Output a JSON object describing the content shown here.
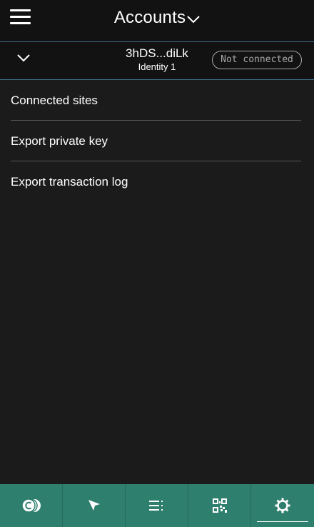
{
  "header": {
    "title": "Accounts",
    "menu_icon": "hamburger-menu-icon",
    "title_dropdown_icon": "chevron-down-icon"
  },
  "account": {
    "address": "3hDS...diLk",
    "name": "Identity 1",
    "status": "Not connected",
    "expand_icon": "chevron-down-icon"
  },
  "menu": {
    "items": [
      {
        "label": "Connected sites"
      },
      {
        "label": "Export private key"
      },
      {
        "label": "Export transaction log"
      }
    ]
  },
  "bottom_nav": {
    "items": [
      {
        "icon": "coins-icon",
        "active": false
      },
      {
        "icon": "send-arrow-icon",
        "active": false
      },
      {
        "icon": "transactions-list-icon",
        "active": false
      },
      {
        "icon": "qr-code-icon",
        "active": false
      },
      {
        "icon": "gear-icon",
        "active": true
      }
    ]
  },
  "colors": {
    "background": "#1b1b1b",
    "header_background": "#121212",
    "account_border": "#3d6d8a",
    "badge_border": "#a8a8a8",
    "bottom_bar": "#2f7f6e",
    "separator": "#555555"
  }
}
